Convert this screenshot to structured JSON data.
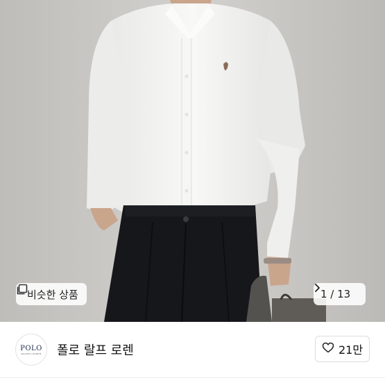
{
  "photo": {
    "description_icon": "product-photo",
    "similar_products": {
      "label": "비슷한 상품",
      "icon": "similar-items-icon"
    },
    "pager": {
      "text": "1 / 13",
      "icon": "chevron-right-icon"
    }
  },
  "shop": {
    "logo_main": "POLO",
    "logo_sub": "RALPH LAUREN",
    "name": "폴로 랄프 로렌",
    "like_count": "21만",
    "like_icon": "heart-outline-icon"
  },
  "colors": {
    "shirt": "#f4f4f2",
    "pants": "#16171b",
    "background": "#c9c7c4"
  }
}
